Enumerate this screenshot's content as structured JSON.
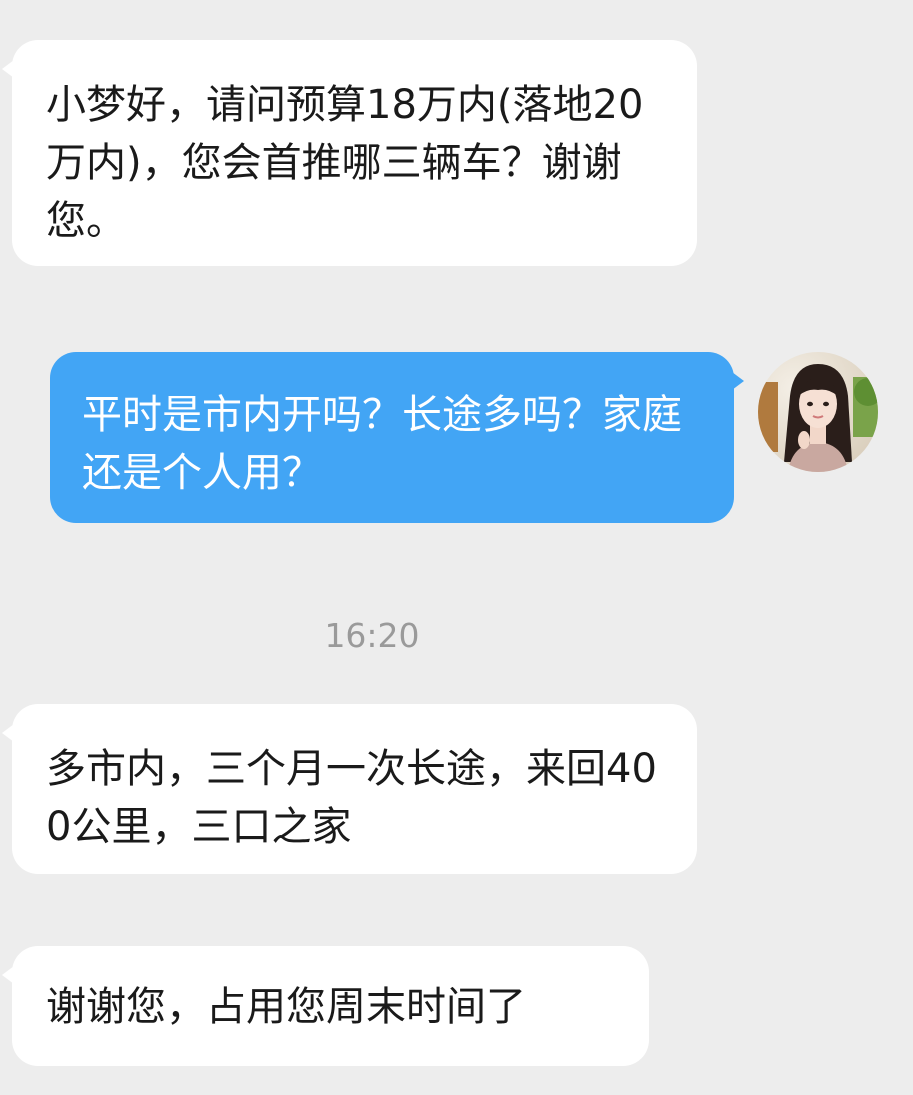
{
  "messages": [
    {
      "id": "msg1",
      "direction": "incoming",
      "text": "小梦好，请问预算18万内(落地20万内)，您会首推哪三辆车？谢谢您。"
    },
    {
      "id": "msg2",
      "direction": "outgoing",
      "text": "平时是市内开吗？长途多吗？家庭还是个人用？"
    },
    {
      "id": "msg3",
      "direction": "incoming",
      "text": "多市内，三个月一次长途，来回400公里，三口之家"
    },
    {
      "id": "msg4",
      "direction": "incoming",
      "text": "谢谢您，占用您周末时间了"
    }
  ],
  "timestamp": "16:20",
  "colors": {
    "background": "#ededed",
    "incoming_bubble": "#ffffff",
    "outgoing_bubble": "#42a5f5",
    "timestamp_text": "#9a9a9a"
  },
  "avatar": {
    "icon": "user-avatar-photo"
  }
}
